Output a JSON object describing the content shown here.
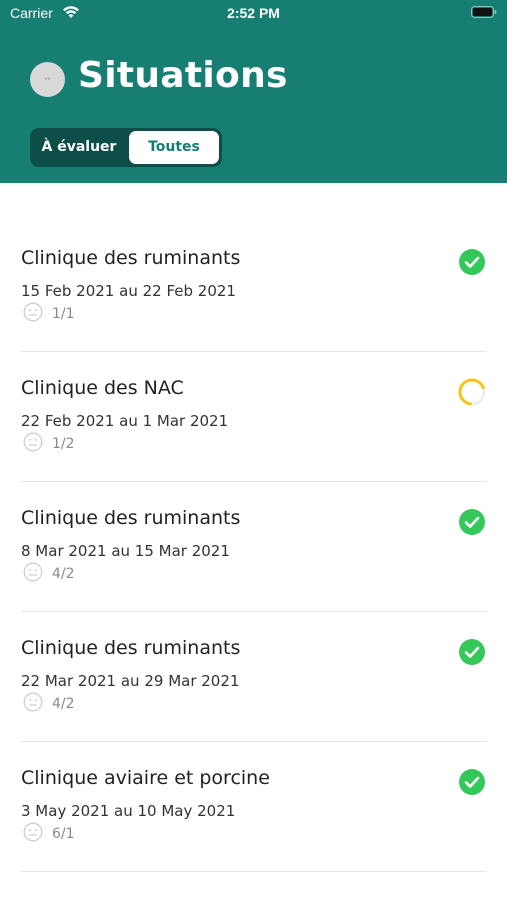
{
  "status_bar": {
    "carrier": "Carrier",
    "time": "2:52 PM"
  },
  "header": {
    "title": "Situations",
    "avatar_initials": "••",
    "segments": [
      "À évaluer",
      "Toutes"
    ],
    "selected_segment": "Toutes",
    "background_color": "#167e73"
  },
  "items": [
    {
      "title": "Clinique des ruminants",
      "dates": "15 Feb 2021 au 22 Feb 2021",
      "count": "1/1",
      "status": "completed"
    },
    {
      "title": "Clinique des NAC",
      "dates": "22 Feb 2021 au 1 Mar 2021",
      "count": "1/2",
      "status": "in-progress"
    },
    {
      "title": "Clinique des ruminants",
      "dates": "8 Mar 2021 au 15 Mar 2021",
      "count": "4/2",
      "status": "completed"
    },
    {
      "title": "Clinique des ruminants",
      "dates": "22 Mar 2021 au 29 Mar 2021",
      "count": "4/2",
      "status": "completed"
    },
    {
      "title": "Clinique aviaire et porcine",
      "dates": "3 May 2021 au 10 May 2021",
      "count": "6/1",
      "status": "completed"
    }
  ],
  "colors": {
    "completed": "#34c759",
    "in_progress": "#f5c518"
  },
  "icons": {
    "count_icon": "face-icon",
    "completed_icon": "check-circle-icon",
    "in_progress_icon": "progress-ring-icon"
  }
}
